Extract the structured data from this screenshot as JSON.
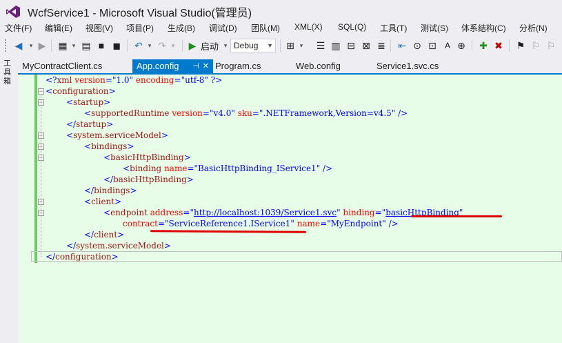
{
  "window": {
    "title": "WcfService1 - Microsoft Visual Studio(管理员)"
  },
  "menu": [
    "文件(F)",
    "编辑(E)",
    "视图(V)",
    "项目(P)",
    "生成(B)",
    "调试(D)",
    "团队(M)",
    "XML(X)",
    "SQL(Q)",
    "工具(T)",
    "测试(S)",
    "体系结构(C)",
    "分析(N)"
  ],
  "toolbar": {
    "start_label": "启动",
    "config_value": "Debug"
  },
  "sidebar": {
    "label": "工具箱"
  },
  "tabs": [
    {
      "label": "MyContractClient.cs",
      "active": false
    },
    {
      "label": "App.config",
      "active": true
    },
    {
      "label": "Program.cs",
      "active": false
    },
    {
      "label": "Web.config",
      "active": false
    },
    {
      "label": "Service1.svc.cs",
      "active": false
    }
  ],
  "code": {
    "l0": {
      "p1": "<?",
      "t": "xml",
      "a1": " version",
      "e1": "=",
      "v1": "\"1.0\"",
      "a2": " encoding",
      "e2": "=",
      "v2": "\"utf-8\"",
      "p2": " ?>"
    },
    "l1": {
      "open": "<",
      "t": "configuration",
      "close": ">"
    },
    "l2": {
      "open": "<",
      "t": "startup",
      "close": ">"
    },
    "l3": {
      "open": "<",
      "t": "supportedRuntime",
      "a1": " version",
      "e1": "=",
      "v1": "\"v4.0\"",
      "a2": " sku",
      "e2": "=",
      "v2": "\".NETFramework,Version=v4.5\"",
      "close": " />"
    },
    "l4": {
      "open": "</",
      "t": "startup",
      "close": ">"
    },
    "l5": {
      "open": "<",
      "t": "system.serviceModel",
      "close": ">"
    },
    "l6": {
      "open": "<",
      "t": "bindings",
      "close": ">"
    },
    "l7": {
      "open": "<",
      "t": "basicHttpBinding",
      "close": ">"
    },
    "l8": {
      "open": "<",
      "t": "binding",
      "a1": " name",
      "e1": "=",
      "v1": "\"BasicHttpBinding_IService1\"",
      "close": " />"
    },
    "l9": {
      "open": "</",
      "t": "basicHttpBinding",
      "close": ">"
    },
    "l10": {
      "open": "</",
      "t": "bindings",
      "close": ">"
    },
    "l11": {
      "open": "<",
      "t": "client",
      "close": ">"
    },
    "l12": {
      "open": "<",
      "t": "endpoint",
      "a1": " address",
      "e1": "=",
      "q1": "\"",
      "v1": "http://localhost:1039/Service1.svc",
      "q1b": "\"",
      "a2": " binding",
      "e2": "=",
      "q2": "\"",
      "v2": "basicHttpBinding",
      "q2b": "\""
    },
    "l13": {
      "a1": "contract",
      "e1": "=",
      "v1": "\"ServiceReference1.IService1\"",
      "a2": " name",
      "e2": "=",
      "v2": "\"MyEndpoint\"",
      "close": " />"
    },
    "l14": {
      "open": "</",
      "t": "client",
      "close": ">"
    },
    "l15": {
      "open": "</",
      "t": "system.serviceModel",
      "close": ">"
    },
    "l16": {
      "open": "</",
      "t": "configuration",
      "close": ">"
    }
  },
  "colors": {
    "accent": "#007acc",
    "editor_bg": "#e7fde8",
    "xml_bracket": "#0000ff",
    "xml_tag": "#a31515",
    "xml_attr": "#ff0000",
    "annotation": "#e00000"
  }
}
